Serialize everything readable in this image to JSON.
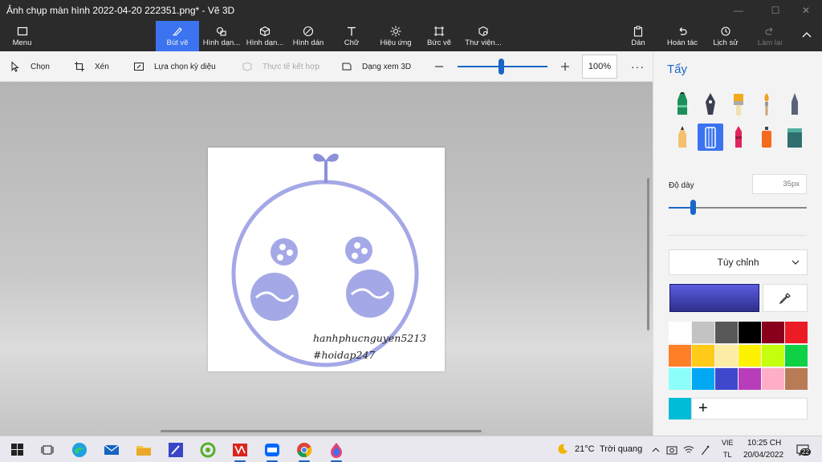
{
  "window": {
    "title": "Ảnh chụp màn hình 2022-04-20 222351.png* - Vẽ 3D"
  },
  "ribbon": {
    "menu": "Menu",
    "items": [
      "Bút vẽ",
      "Hình dạn...",
      "Hình dạn...",
      "Hình dán",
      "Chữ",
      "Hiệu ứng",
      "Bức vẽ",
      "Thư viện..."
    ],
    "active_index": 0,
    "paste": "Dán",
    "undo": "Hoàn tác",
    "history": "Lịch sử",
    "redo": "Làm lại"
  },
  "toolbar": {
    "select": "Chọn",
    "crop": "Xén",
    "magic_select": "Lựa chọn kỳ diệu",
    "mixed_reality": "Thực tế kết hợp",
    "view_3d": "Dạng xem 3D",
    "zoom_value": "100%",
    "zoom_level": 0.5
  },
  "canvas": {
    "watermark_line1": "hanhphucnguyen5213",
    "watermark_line2": "#hoidap247",
    "drawing_color": "#a5a8e6"
  },
  "panel": {
    "title": "Tẩy",
    "thickness_label": "Độ dày",
    "thickness_value": "35px",
    "thickness_level": 0.18,
    "dropdown_value": "Tùy chỉnh",
    "current_color": "#3b3db0",
    "brushes": [
      "marker",
      "calligraphy-pen",
      "oil-brush",
      "watercolor",
      "pixel-pen",
      "pencil",
      "eraser",
      "crayon",
      "spray-can",
      "fill-bucket"
    ],
    "selected_brush": "eraser",
    "palette": [
      "#ffffff",
      "#c3c3c3",
      "#585858",
      "#000000",
      "#88001b",
      "#ec1c24",
      "#ff7f27",
      "#ffca18",
      "#fdeca6",
      "#fff200",
      "#c4ff0e",
      "#0ed145",
      "#8cfffb",
      "#00a8f3",
      "#3f48cc",
      "#b83dba",
      "#ffaec8",
      "#b97a56"
    ],
    "custom_color": "#00bcd9",
    "add_label": "+"
  },
  "taskbar": {
    "apps": [
      "windows-start",
      "task-view",
      "edge",
      "mail",
      "file-explorer",
      "paint-3d-pen",
      "greenapp",
      "vietjet",
      "zalo",
      "chrome",
      "paint-3d"
    ],
    "weather_temp": "21°C",
    "weather_text": "Trời quang",
    "lang_line1": "VIE",
    "lang_line2": "TL",
    "time": "10:25 CH",
    "date": "20/04/2022",
    "notifications": "22"
  }
}
